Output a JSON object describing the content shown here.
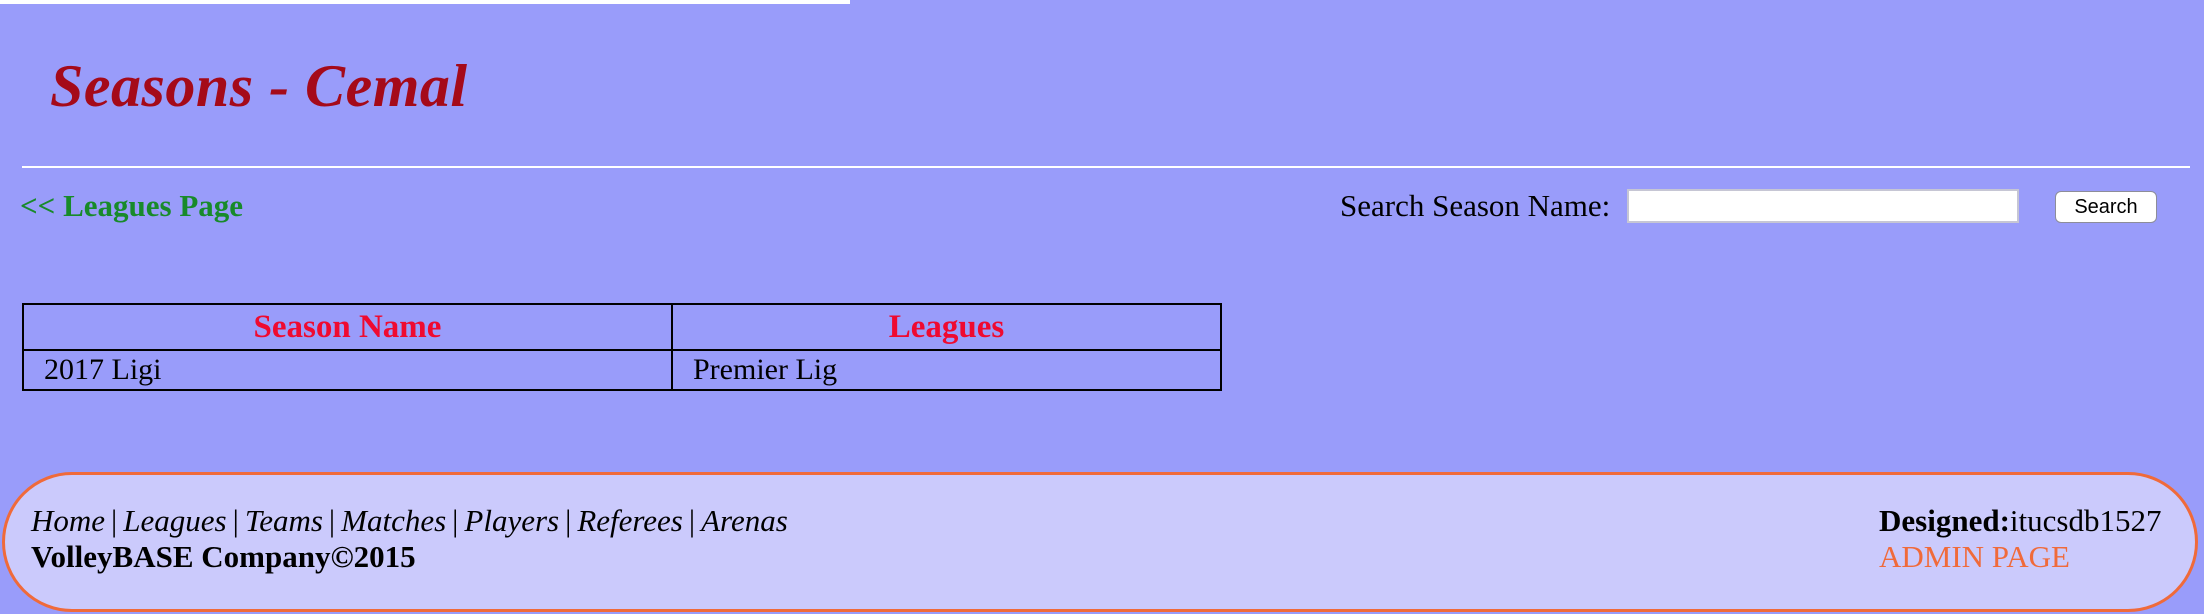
{
  "header": {
    "title": "Seasons - Cemal"
  },
  "nav": {
    "back_link": "<< Leagues Page"
  },
  "search": {
    "label": "Search Season Name:",
    "value": "",
    "placeholder": "",
    "button_label": "Search"
  },
  "table": {
    "headers": [
      "Season Name",
      "Leagues"
    ],
    "rows": [
      [
        "2017 Ligi",
        "Premier Lig"
      ]
    ]
  },
  "footer": {
    "nav_links": [
      "Home",
      "Leagues",
      "Teams",
      "Matches",
      "Players",
      "Referees",
      "Arenas"
    ],
    "separator": "|",
    "company": "VolleyBASE Company©2015",
    "designed_label": "Designed:",
    "designed_value": "itucsdb1527",
    "admin_link": "ADMIN PAGE"
  },
  "colors": {
    "background": "#999cfa",
    "title": "#a50a19",
    "back_link": "#188a2a",
    "table_header": "#ef0a30",
    "footer_bg": "#cbcafc",
    "footer_border": "#f06a3a",
    "admin_link": "#f06a3a"
  }
}
